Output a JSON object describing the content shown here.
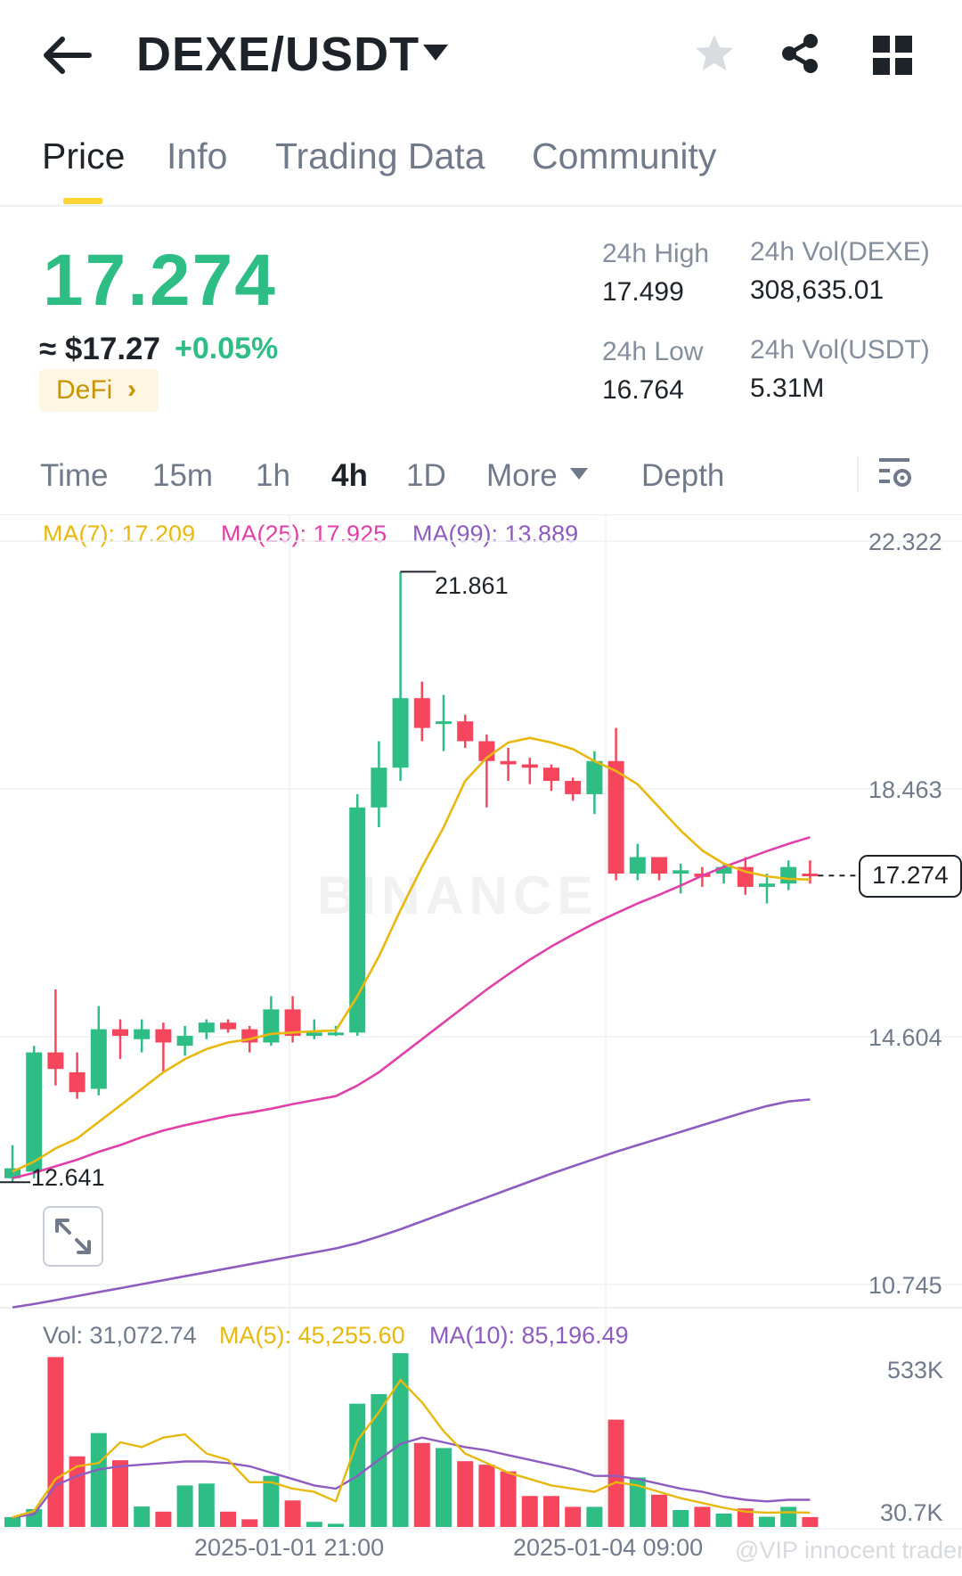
{
  "header": {
    "pair": "DEXE/USDT",
    "icons": [
      "back-arrow-icon",
      "dropdown-caret-icon",
      "star-icon",
      "share-icon",
      "grid-menu-icon"
    ]
  },
  "tabs": [
    {
      "label": "Price",
      "active": true
    },
    {
      "label": "Info",
      "active": false
    },
    {
      "label": "Trading Data",
      "active": false
    },
    {
      "label": "Community",
      "active": false
    }
  ],
  "ticker": {
    "price": "17.274",
    "usd_price": "≈ $17.27",
    "change": "+0.05%",
    "tag": "DeFi",
    "high_label": "24h High",
    "high": "17.499",
    "low_label": "24h Low",
    "low": "16.764",
    "vol_base_label": "24h Vol(DEXE)",
    "vol_base": "308,635.01",
    "vol_quote_label": "24h Vol(USDT)",
    "vol_quote": "5.31M"
  },
  "intervals": {
    "items": [
      "Time",
      "15m",
      "1h",
      "4h",
      "1D",
      "More",
      "Depth"
    ],
    "active": "4h"
  },
  "ma_legend": {
    "ma7": "MA(7): 17.209",
    "ma25": "MA(25): 17.925",
    "ma99": "MA(99): 13.889"
  },
  "price_axis": {
    "labels": [
      "22.322",
      "18.463",
      "14.604",
      "10.745"
    ],
    "current": "17.274",
    "high_marker": "21.861",
    "low_marker": "12.641"
  },
  "volume": {
    "vol": "Vol: 31,072.74",
    "ma5": "MA(5): 45,255.60",
    "ma10": "MA(10): 85,196.49",
    "axis_top": "533K",
    "axis_bottom": "30.7K"
  },
  "time_axis": [
    "2025-01-01 21:00",
    "2025-01-04 09:00"
  ],
  "watermark": "BINANCE",
  "credit": "@VIP innocent trader",
  "colors": {
    "up": "#2ebd85",
    "down": "#f6465d",
    "ma7": "#e8b80f",
    "ma25": "#e040a8",
    "ma99": "#8e5cc0",
    "accent": "#fcd535"
  },
  "chart_data": {
    "type": "candlestick",
    "interval": "4h",
    "y_range": [
      10.745,
      22.322
    ],
    "candles": [
      {
        "o": 12.7,
        "h": 13.2,
        "l": 12.64,
        "c": 12.85
      },
      {
        "o": 12.8,
        "h": 14.7,
        "l": 12.7,
        "c": 14.6
      },
      {
        "o": 14.6,
        "h": 15.55,
        "l": 14.1,
        "c": 14.35
      },
      {
        "o": 14.3,
        "h": 14.6,
        "l": 13.9,
        "c": 14.0
      },
      {
        "o": 14.05,
        "h": 15.3,
        "l": 13.95,
        "c": 14.95
      },
      {
        "o": 14.95,
        "h": 15.1,
        "l": 14.5,
        "c": 14.85
      },
      {
        "o": 14.8,
        "h": 15.1,
        "l": 14.6,
        "c": 14.95
      },
      {
        "o": 14.95,
        "h": 15.05,
        "l": 14.3,
        "c": 14.75
      },
      {
        "o": 14.7,
        "h": 15.0,
        "l": 14.55,
        "c": 14.85
      },
      {
        "o": 14.9,
        "h": 15.1,
        "l": 14.8,
        "c": 15.05
      },
      {
        "o": 15.05,
        "h": 15.1,
        "l": 14.9,
        "c": 14.95
      },
      {
        "o": 14.95,
        "h": 15.0,
        "l": 14.6,
        "c": 14.75
      },
      {
        "o": 14.75,
        "h": 15.45,
        "l": 14.7,
        "c": 15.25
      },
      {
        "o": 15.25,
        "h": 15.45,
        "l": 14.75,
        "c": 14.85
      },
      {
        "o": 14.85,
        "h": 15.1,
        "l": 14.8,
        "c": 14.9
      },
      {
        "o": 14.9,
        "h": 15.0,
        "l": 14.85,
        "c": 14.9
      },
      {
        "o": 14.9,
        "h": 18.5,
        "l": 14.85,
        "c": 18.3
      },
      {
        "o": 18.3,
        "h": 19.3,
        "l": 18.0,
        "c": 18.9
      },
      {
        "o": 18.9,
        "h": 21.86,
        "l": 18.7,
        "c": 19.95
      },
      {
        "o": 19.95,
        "h": 20.2,
        "l": 19.3,
        "c": 19.5
      },
      {
        "o": 19.6,
        "h": 20.0,
        "l": 19.15,
        "c": 19.6
      },
      {
        "o": 19.6,
        "h": 19.7,
        "l": 19.2,
        "c": 19.3
      },
      {
        "o": 19.3,
        "h": 19.4,
        "l": 18.3,
        "c": 19.0
      },
      {
        "o": 19.0,
        "h": 19.2,
        "l": 18.7,
        "c": 18.95
      },
      {
        "o": 18.95,
        "h": 19.05,
        "l": 18.65,
        "c": 18.9
      },
      {
        "o": 18.9,
        "h": 18.95,
        "l": 18.55,
        "c": 18.7
      },
      {
        "o": 18.7,
        "h": 18.75,
        "l": 18.4,
        "c": 18.5
      },
      {
        "o": 18.5,
        "h": 19.15,
        "l": 18.2,
        "c": 19.0
      },
      {
        "o": 19.0,
        "h": 19.5,
        "l": 17.2,
        "c": 17.3
      },
      {
        "o": 17.3,
        "h": 17.75,
        "l": 17.2,
        "c": 17.55
      },
      {
        "o": 17.55,
        "h": 17.55,
        "l": 17.2,
        "c": 17.3
      },
      {
        "o": 17.3,
        "h": 17.45,
        "l": 17.0,
        "c": 17.35
      },
      {
        "o": 17.3,
        "h": 17.4,
        "l": 17.1,
        "c": 17.25
      },
      {
        "o": 17.3,
        "h": 17.45,
        "l": 17.15,
        "c": 17.4
      },
      {
        "o": 17.4,
        "h": 17.55,
        "l": 16.98,
        "c": 17.1
      },
      {
        "o": 17.1,
        "h": 17.3,
        "l": 16.85,
        "c": 17.15
      },
      {
        "o": 17.15,
        "h": 17.5,
        "l": 17.05,
        "c": 17.4
      },
      {
        "o": 17.3,
        "h": 17.5,
        "l": 17.15,
        "c": 17.27
      }
    ],
    "ma7": [
      12.8,
      12.95,
      13.15,
      13.3,
      13.55,
      13.8,
      14.05,
      14.3,
      14.5,
      14.65,
      14.75,
      14.8,
      14.88,
      14.9,
      14.92,
      14.93,
      15.45,
      16.05,
      16.75,
      17.4,
      18.0,
      18.7,
      19.05,
      19.28,
      19.35,
      19.28,
      19.18,
      19.0,
      18.85,
      18.65,
      18.3,
      17.95,
      17.65,
      17.45,
      17.33,
      17.26,
      17.22,
      17.21
    ],
    "ma25": [
      12.7,
      12.78,
      12.88,
      12.98,
      13.1,
      13.2,
      13.32,
      13.42,
      13.5,
      13.57,
      13.64,
      13.69,
      13.75,
      13.82,
      13.88,
      13.94,
      14.1,
      14.3,
      14.55,
      14.8,
      15.05,
      15.3,
      15.55,
      15.78,
      16.0,
      16.2,
      16.38,
      16.55,
      16.7,
      16.85,
      16.98,
      17.12,
      17.27,
      17.4,
      17.52,
      17.64,
      17.75,
      17.85
    ],
    "ma99": [
      10.75,
      10.8,
      10.86,
      10.92,
      10.98,
      11.04,
      11.1,
      11.16,
      11.22,
      11.28,
      11.34,
      11.4,
      11.46,
      11.52,
      11.58,
      11.64,
      11.72,
      11.82,
      11.93,
      12.05,
      12.17,
      12.29,
      12.41,
      12.53,
      12.65,
      12.77,
      12.88,
      12.99,
      13.1,
      13.2,
      13.3,
      13.4,
      13.5,
      13.6,
      13.7,
      13.79,
      13.86,
      13.89
    ],
    "volume": [
      31,
      56,
      532,
      221,
      294,
      209,
      64,
      48,
      130,
      136,
      48,
      24,
      160,
      83,
      16,
      10,
      386,
      416,
      544,
      263,
      247,
      206,
      195,
      174,
      97,
      97,
      63,
      63,
      336,
      155,
      101,
      53,
      63,
      42,
      58,
      32,
      63,
      31
    ],
    "volume_unit": "K",
    "vol_ma5": [
      30,
      50,
      150,
      190,
      200,
      265,
      250,
      280,
      290,
      230,
      210,
      140,
      140,
      120,
      110,
      80,
      270,
      360,
      460,
      390,
      300,
      230,
      200,
      170,
      150,
      130,
      120,
      110,
      140,
      130,
      110,
      90,
      75,
      60,
      48,
      45,
      46,
      45
    ],
    "vol_ma10": [
      30,
      40,
      130,
      160,
      180,
      190,
      195,
      200,
      205,
      205,
      200,
      190,
      170,
      150,
      130,
      120,
      160,
      210,
      260,
      280,
      265,
      250,
      240,
      225,
      210,
      195,
      180,
      160,
      160,
      150,
      135,
      120,
      110,
      95,
      85,
      80,
      85,
      85
    ],
    "x_ticks": [
      {
        "index": 13,
        "label": "2025-01-01 21:00"
      },
      {
        "index": 28,
        "label": "2025-01-04 09:00"
      }
    ]
  }
}
